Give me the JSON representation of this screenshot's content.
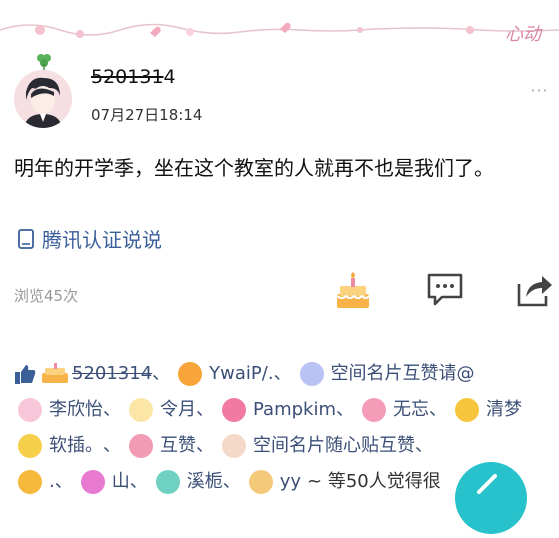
{
  "header": {
    "decor_text": "心动"
  },
  "post": {
    "username_struck": "520131",
    "username_tail": "4",
    "timestamp": "07月27日18:14",
    "content": "明年的开学季，坐在这个教室的人就再不也是我们了。",
    "source": "腾讯认证说说",
    "views": "浏览45次"
  },
  "actions": {
    "celebrate_icon": "cake-icon",
    "comment_icon": "comment-icon",
    "share_icon": "share-icon"
  },
  "likes": {
    "first_struck": "5201314",
    "names": [
      "YwaiP/.",
      "空间名片互赞请@",
      "李欣怡",
      "令月",
      "Pampkim",
      "无忘",
      "清梦",
      "软插。",
      "互赞",
      "空间名片随心贴互赞",
      ".",
      "山",
      "溪栀",
      "yy"
    ],
    "summary": "~ 等50人觉得很"
  },
  "colors": {
    "accent": "#27c2cc",
    "link": "#3b4f77",
    "source": "#3a5f99"
  }
}
